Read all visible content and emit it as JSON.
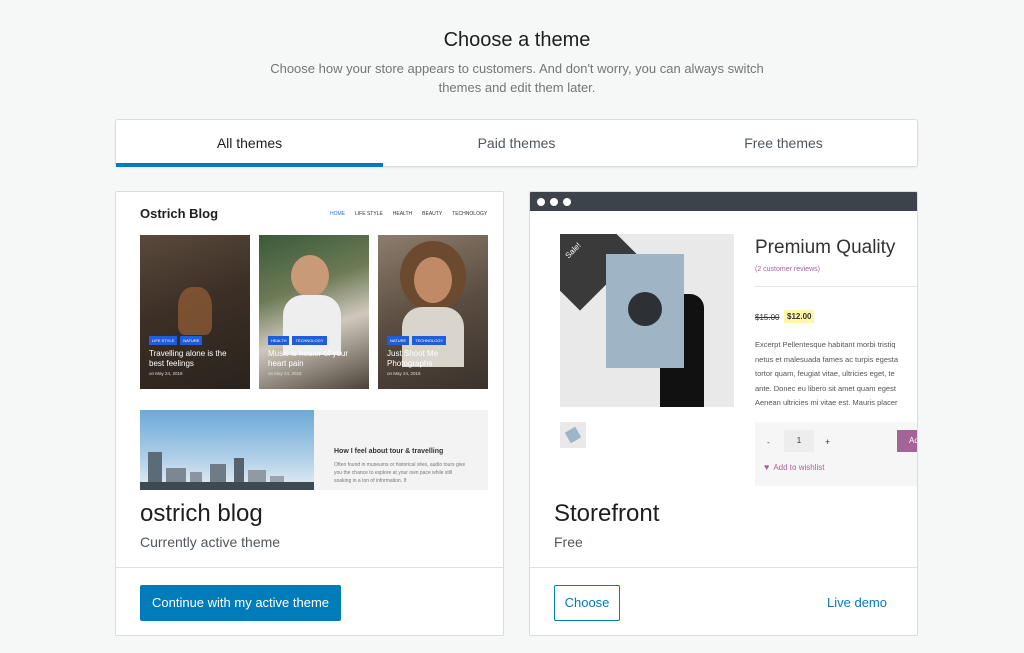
{
  "header": {
    "title": "Choose a theme",
    "subtitle": "Choose how your store appears to customers. And don't worry, you can always switch themes and edit them later."
  },
  "tabs": [
    {
      "label": "All themes",
      "active": true
    },
    {
      "label": "Paid themes",
      "active": false
    },
    {
      "label": "Free themes",
      "active": false
    }
  ],
  "themes": [
    {
      "name": "ostrich blog",
      "status": "Currently active theme",
      "primary_action": "Continue with my active theme",
      "preview": {
        "logo": "Ostrich Blog",
        "nav": [
          "HOME",
          "LIFE STYLE",
          "HEALTH",
          "BEAUTY",
          "TECHNOLOGY"
        ],
        "posts": [
          {
            "tags": [
              "LIFE STYLE",
              "NATURE"
            ],
            "title": "Travelling alone is the best feelings",
            "date": "on May 24, 2018"
          },
          {
            "tags": [
              "HEALTH",
              "TECHNOLOGY"
            ],
            "title": "Music is healer of your heart pain",
            "date": "on May 24, 2018"
          },
          {
            "tags": [
              "NATURE",
              "TECHNOLOGY"
            ],
            "title": "Just Shoot Me Photographs",
            "date": "on May 24, 2018"
          }
        ],
        "banner_title": "How I feel about tour & travelling",
        "banner_text": "Often found in museums or historical sites, audio tours give you the chance to explore at your own pace while still soaking in a ton of information. If"
      }
    },
    {
      "name": "Storefront",
      "status": "Free",
      "secondary_action": "Choose",
      "link": "Live demo",
      "preview": {
        "product_title": "Premium Quality",
        "reviews": "(2 customer reviews)",
        "old_price": "$15.00",
        "new_price": "$12.00",
        "sale_badge": "Sale!",
        "excerpt_lines": [
          "Excerpt Pellentesque habitant morbi tristiq",
          "netus et malesuada fames ac turpis egesta",
          "tortor quam, feugiat vitae, ultricies eget, te",
          "ante. Donec eu libero sit amet quam egest",
          "Aenean ultricies mi vitae est. Mauris placer"
        ],
        "qty_minus": "-",
        "qty": "1",
        "qty_plus": "+",
        "add_button": "Ad",
        "wishlist": "Add to wishlist"
      }
    }
  ],
  "colors": {
    "accent": "#007cba",
    "background": "#f6f7f7",
    "woo_purple": "#a46497"
  }
}
